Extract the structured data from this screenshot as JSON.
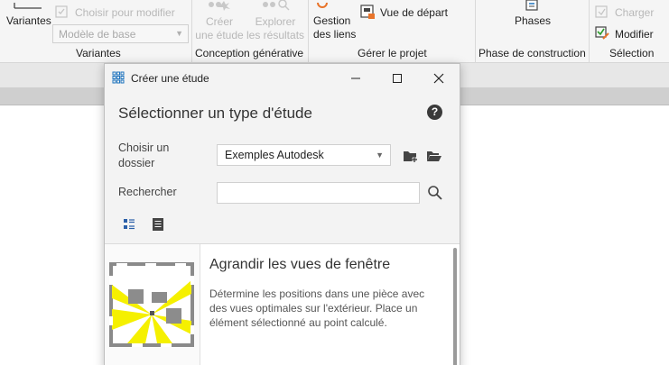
{
  "ribbon": {
    "variantes_button": "Variantes",
    "choisir_modifier": "Choisir pour modifier",
    "modele_de_base": "Modèle de base",
    "panel_variantes": "Variantes",
    "creer_etude": [
      "Créer",
      "une étude"
    ],
    "explorer_resultats": [
      "Explorer",
      "les résultats"
    ],
    "panel_conception": "Conception générative",
    "gestion_liens": [
      "Gestion",
      "des liens"
    ],
    "vue_depart": "Vue de départ",
    "panel_gerer": "Gérer le projet",
    "phases": "Phases",
    "panel_phase": "Phase de construction",
    "charger": "Charger",
    "modifier": "Modifier",
    "panel_selection": "Sélection"
  },
  "dialog": {
    "title": "Créer une étude",
    "heading": "Sélectionner un type d'étude",
    "help_glyph": "?",
    "folder_label": "Choisir un dossier",
    "folder_value": "Exemples Autodesk",
    "search_label": "Rechercher",
    "search_value": "",
    "item": {
      "title": "Agrandir les vues de fenêtre",
      "description": "Détermine les positions dans une pièce avec des vues optimales sur l'extérieur. Place un élément sélectionné au point calculé."
    }
  },
  "colors": {
    "accent": "#1e73be",
    "ray_yellow": "#f5f000",
    "ribbon_bg": "#f5f5f5",
    "dialog_bg": "#f3f3f3"
  }
}
